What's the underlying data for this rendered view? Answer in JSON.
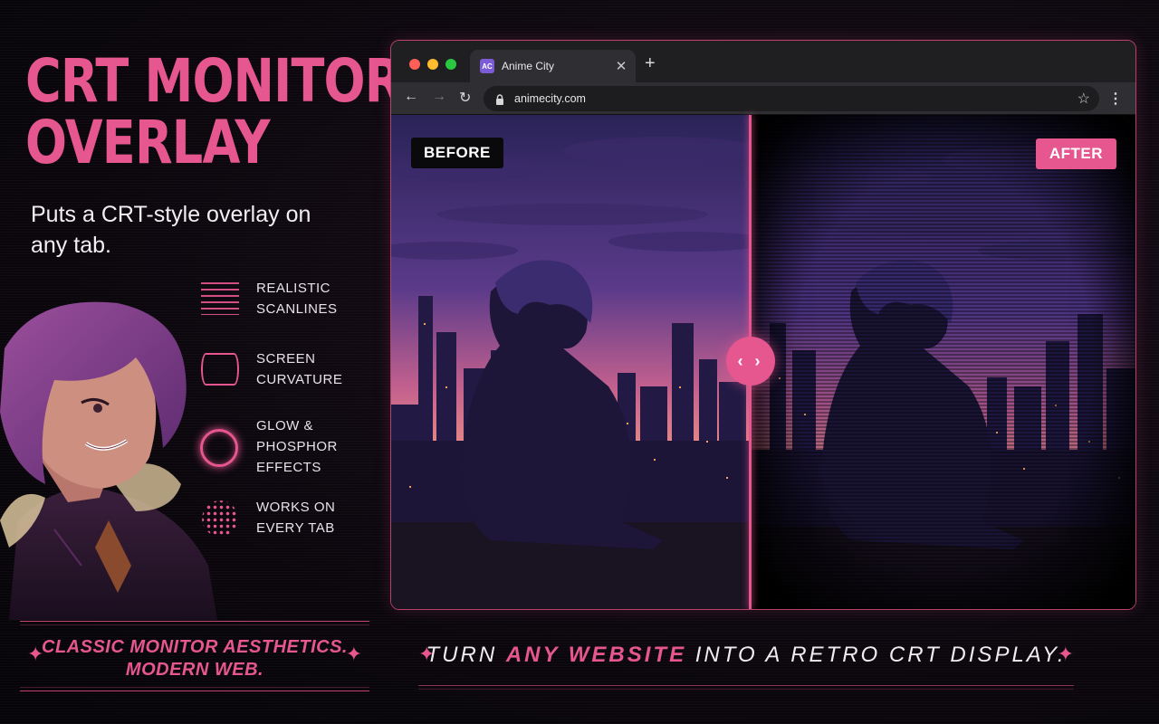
{
  "colors": {
    "accent": "#e6568f",
    "background": "#0b070d",
    "tab_bg": "#2e2e33",
    "traffic_red": "#ff5f57",
    "traffic_yellow": "#febc2e",
    "traffic_green": "#28c840"
  },
  "promo": {
    "headline_line1": "CRT MONITOR",
    "headline_line2": "OVERLAY",
    "subtitle": "Puts a CRT-style overlay on any tab.",
    "features": [
      {
        "icon": "scanlines-icon",
        "label": "REALISTIC\nSCANLINES"
      },
      {
        "icon": "curvature-icon",
        "label": "SCREEN\nCURVATURE"
      },
      {
        "icon": "glow-ring-icon",
        "label": "GLOW &\nPHOSPHOR\nEFFECTS"
      },
      {
        "icon": "dot-pattern-icon",
        "label": "WORKS ON\nEVERY TAB"
      }
    ],
    "tagline_line1": "CLASSIC MONITOR AESTHETICS.",
    "tagline_line2": "MODERN WEB."
  },
  "browser": {
    "tab": {
      "favicon_text": "AC",
      "title": "Anime City",
      "close_glyph": "✕"
    },
    "new_tab_glyph": "+",
    "nav": {
      "back": "←",
      "forward": "→",
      "reload": "↻"
    },
    "address": {
      "url": "animecity.com"
    },
    "star_glyph": "☆",
    "menu_glyph": "⋮"
  },
  "comparison": {
    "before_label": "BEFORE",
    "after_label": "AFTER",
    "handle_glyph": "‹ ›"
  },
  "caption": {
    "part1": "TURN ",
    "accent": "ANY WEBSITE",
    "part2": " INTO A RETRO CRT DISPLAY."
  }
}
